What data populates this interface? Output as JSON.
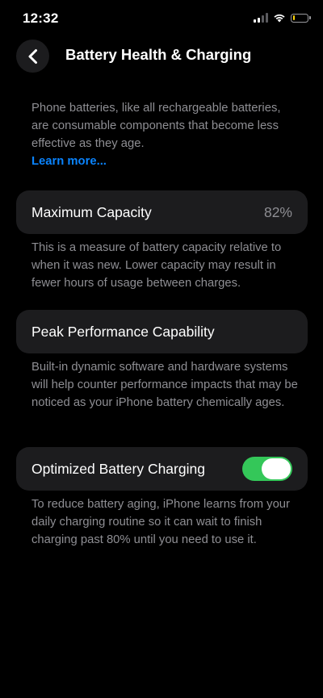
{
  "status_bar": {
    "time": "12:32",
    "battery_level": 0.15,
    "battery_color": "#ffd60a",
    "icons": [
      "signal-icon",
      "wifi-icon",
      "battery-icon"
    ]
  },
  "nav": {
    "back_icon": "chevron-left-icon",
    "title": "Battery Health & Charging"
  },
  "intro": {
    "text": "Phone batteries, like all rechargeable batteries, are consumable components that become less effective as they age.",
    "learn_more": "Learn more..."
  },
  "maximum_capacity": {
    "label": "Maximum Capacity",
    "value": "82%",
    "description": "This is a measure of battery capacity relative to when it was new. Lower capacity may result in fewer hours of usage between charges."
  },
  "peak_performance": {
    "label": "Peak Performance Capability",
    "description": "Built-in dynamic software and hardware systems will help counter performance impacts that may be noticed as your iPhone battery chemically ages."
  },
  "optimized_charging": {
    "label": "Optimized Battery Charging",
    "enabled": true,
    "toggle_color": "#34c759",
    "description": "To reduce battery aging, iPhone learns from your daily charging routine so it can wait to finish charging past 80% until you need to use it."
  },
  "colors": {
    "background": "#000000",
    "card": "#1c1c1e",
    "secondary_text": "#8e8e93",
    "link": "#0a84ff"
  }
}
